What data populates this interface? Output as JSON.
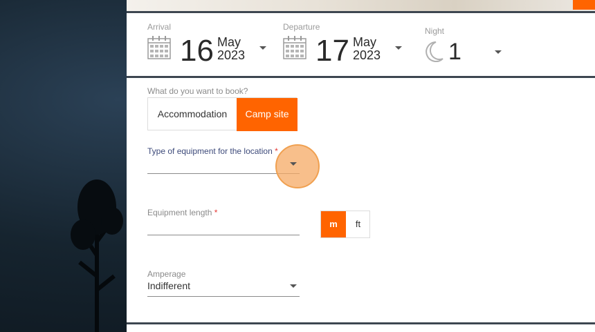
{
  "dates": {
    "arrival": {
      "label": "Arrival",
      "day": "16",
      "month": "May",
      "year": "2023"
    },
    "departure": {
      "label": "Departure",
      "day": "17",
      "month": "May",
      "year": "2023"
    },
    "night": {
      "label": "Night",
      "count": "1"
    }
  },
  "booking": {
    "question": "What do you want to book?",
    "options": [
      "Accommodation",
      "Camp site"
    ],
    "selected": "Camp site"
  },
  "equipment_type": {
    "label": "Type of equipment for the location",
    "required_mark": "*",
    "value": ""
  },
  "equipment_length": {
    "label": "Equipment length",
    "required_mark": "*",
    "value": "",
    "units": [
      "m",
      "ft"
    ],
    "selected_unit": "m"
  },
  "amperage": {
    "label": "Amperage",
    "value": "Indifferent"
  },
  "colors": {
    "accent": "#ff6400",
    "bar_border": "#3d4650"
  },
  "icons": [
    "calendar-icon",
    "moon-icon",
    "chevron-down-icon"
  ]
}
